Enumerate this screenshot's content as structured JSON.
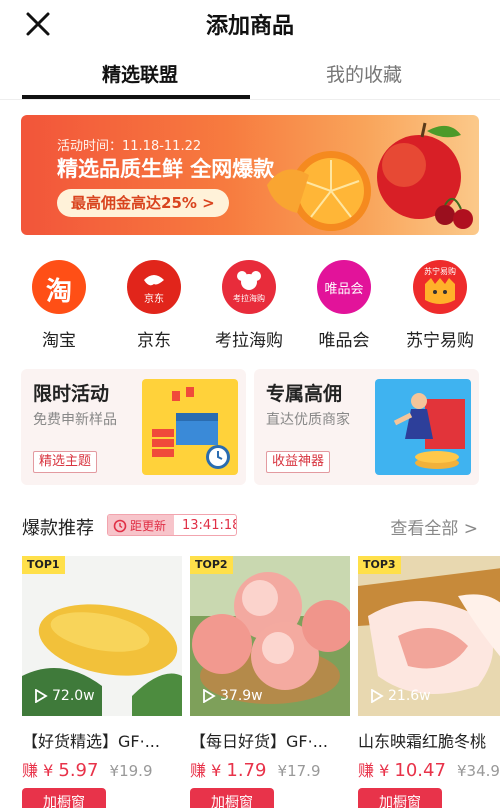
{
  "header": {
    "title": "添加商品"
  },
  "tabs": [
    {
      "label": "精选联盟",
      "active": true
    },
    {
      "label": "我的收藏",
      "active": false
    }
  ],
  "banner": {
    "time_text": "活动时间：11.18-11.22",
    "headline": "精选品质生鲜 全网爆款",
    "pill_text": "最高佣金高达25% >"
  },
  "platforms": [
    {
      "label": "淘宝",
      "icon_text": "淘",
      "color": "#ff4f16"
    },
    {
      "label": "京东",
      "icon_text": "京东",
      "color": "#e1251b"
    },
    {
      "label": "考拉海购",
      "icon_text": "考拉海购",
      "color": "#e82c3b"
    },
    {
      "label": "唯品会",
      "icon_text": "唯品会",
      "color": "#e2139a"
    },
    {
      "label": "苏宁易购",
      "icon_text": "苏宁易购",
      "color": "#ee2b2b"
    }
  ],
  "promos": [
    {
      "title": "限时活动",
      "subtitle": "免费申新样品",
      "tag": "精选主题"
    },
    {
      "title": "专属高佣",
      "subtitle": "直达优质商家",
      "tag": "收益神器"
    }
  ],
  "section": {
    "title": "爆款推荐",
    "countdown_label": "距更新",
    "countdown_time": "13:41:18",
    "see_all": "查看全部 >"
  },
  "products": [
    {
      "badge": "TOP1",
      "views": "72.0w",
      "name": "【好货精选】GF·...",
      "earn_prefix": "赚 ¥",
      "earn": "5.97",
      "original": "¥19.9",
      "buy": "加橱窗"
    },
    {
      "badge": "TOP2",
      "views": "37.9w",
      "name": "【每日好货】GF·...",
      "earn_prefix": "赚 ¥",
      "earn": "1.79",
      "original": "¥17.9",
      "buy": "加橱窗"
    },
    {
      "badge": "TOP3",
      "views": "21.6w",
      "name": "山东映霜红脆冬桃",
      "earn_prefix": "赚 ¥",
      "earn": "10.47",
      "original": "¥34.9",
      "buy": "加橱窗"
    }
  ],
  "colors": {
    "accent": "#e8334a",
    "banner_orange": "#f2553a"
  }
}
